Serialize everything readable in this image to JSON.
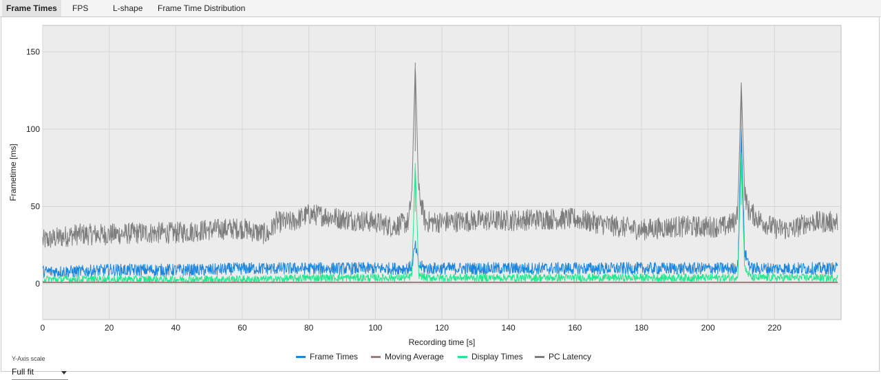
{
  "tabs": [
    {
      "label": "Frame Times",
      "active": true
    },
    {
      "label": "FPS",
      "active": false
    },
    {
      "label": "L-shape",
      "active": false
    },
    {
      "label": "Frame Time Distribution",
      "active": false
    }
  ],
  "y_axis_scale": {
    "label": "Y-Axis scale",
    "value": "Full fit"
  },
  "chart_data": {
    "type": "line",
    "xlabel": "Recording time [s]",
    "ylabel": "Frametime [ms]",
    "xlim": [
      0,
      240
    ],
    "ylim": [
      -23,
      167
    ],
    "x_ticks": [
      0,
      20,
      40,
      60,
      80,
      100,
      120,
      140,
      160,
      180,
      200,
      220
    ],
    "y_ticks": [
      0,
      50,
      100,
      150
    ],
    "grid": true,
    "legend_position": "bottom-center",
    "series": [
      {
        "name": "Frame Times",
        "color": "#1c86dc",
        "x": [
          0,
          10,
          20,
          30,
          40,
          50,
          60,
          70,
          80,
          90,
          100,
          110,
          111,
          112,
          113,
          115,
          120,
          130,
          140,
          150,
          160,
          170,
          180,
          190,
          200,
          208,
          209,
          210,
          211,
          213,
          220,
          230,
          239
        ],
        "y": [
          8,
          8,
          9,
          9,
          9,
          9,
          10,
          10,
          10,
          10,
          10,
          10,
          12,
          25,
          12,
          10,
          10,
          10,
          10,
          10,
          10,
          10,
          10,
          10,
          10,
          10,
          12,
          100,
          20,
          10,
          10,
          10,
          10
        ]
      },
      {
        "name": "Moving Average",
        "color": "#9e7b7b",
        "x": [
          0,
          60,
          120,
          180,
          239
        ],
        "y": [
          1,
          1,
          1,
          1,
          1
        ]
      },
      {
        "name": "Display Times",
        "color": "#1fe88c",
        "x": [
          0,
          10,
          20,
          30,
          40,
          50,
          60,
          70,
          80,
          90,
          100,
          110,
          111,
          112,
          113,
          115,
          120,
          130,
          140,
          150,
          160,
          170,
          180,
          190,
          200,
          208,
          209,
          210,
          211,
          213,
          220,
          230,
          239
        ],
        "y": [
          3,
          3,
          3,
          3,
          3,
          3,
          3,
          3,
          4,
          4,
          4,
          4,
          6,
          78,
          6,
          4,
          4,
          4,
          4,
          4,
          4,
          4,
          4,
          4,
          4,
          4,
          6,
          85,
          10,
          4,
          4,
          4,
          4
        ]
      },
      {
        "name": "PC Latency",
        "color": "#7d7d7d",
        "x": [
          0,
          5,
          10,
          20,
          30,
          40,
          50,
          60,
          65,
          68,
          70,
          75,
          80,
          85,
          90,
          100,
          105,
          110,
          111,
          112,
          113,
          115,
          120,
          130,
          140,
          150,
          160,
          170,
          180,
          190,
          200,
          205,
          208,
          209,
          210,
          211,
          212,
          215,
          220,
          225,
          230,
          239
        ],
        "y": [
          28,
          30,
          32,
          32,
          33,
          33,
          35,
          36,
          33,
          32,
          40,
          40,
          45,
          44,
          42,
          40,
          37,
          40,
          60,
          143,
          60,
          40,
          40,
          41,
          41,
          42,
          42,
          38,
          35,
          37,
          37,
          37,
          40,
          50,
          130,
          60,
          48,
          42,
          36,
          35,
          40,
          40
        ]
      }
    ]
  }
}
